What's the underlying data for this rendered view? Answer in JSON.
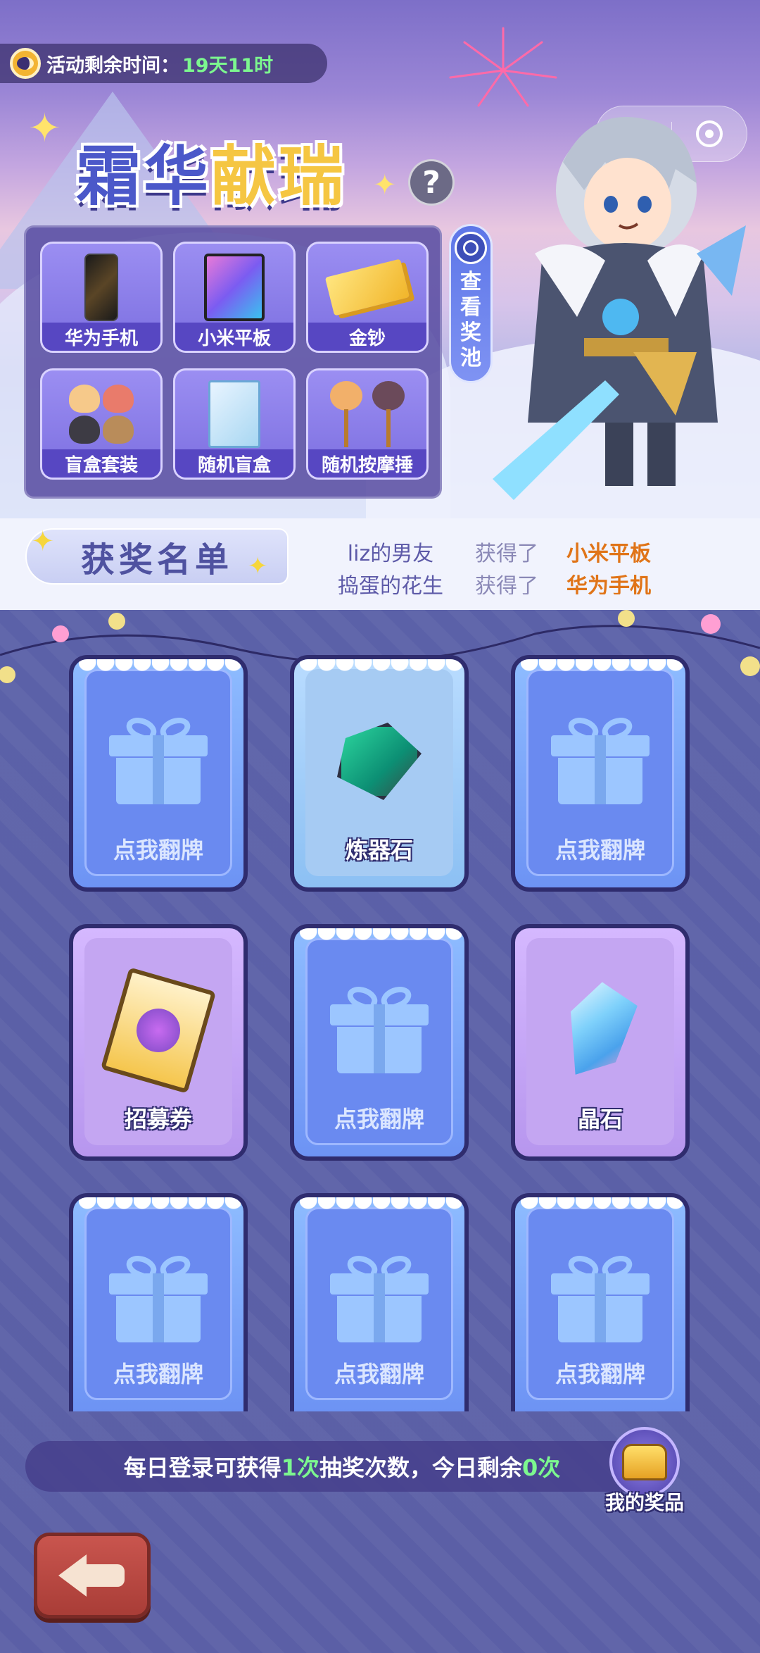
{
  "event": {
    "timer_label": "活动剩余时间：",
    "timer_value": "19天11时",
    "title_part1": "霜华",
    "title_part2": "献瑞",
    "help": "?"
  },
  "miniapp_menu": {
    "more": "•••"
  },
  "prize_pool": {
    "view_button": "查看奖池",
    "items": [
      {
        "label": "华为手机",
        "icon": "phone-icon"
      },
      {
        "label": "小米平板",
        "icon": "tablet-icon"
      },
      {
        "label": "金钞",
        "icon": "gold-note-icon"
      },
      {
        "label": "盲盒套装",
        "icon": "blindbox-set-icon"
      },
      {
        "label": "随机盲盒",
        "icon": "blindbox-icon"
      },
      {
        "label": "随机按摩捶",
        "icon": "massage-hammer-icon"
      }
    ]
  },
  "winners": {
    "title": "获奖名单",
    "rows": [
      {
        "name": "liz的男友",
        "action": "获得了",
        "item": "小米平板"
      },
      {
        "name": "捣蛋的花生",
        "action": "获得了",
        "item": "华为手机"
      }
    ]
  },
  "cards": [
    {
      "state": "back",
      "caption": "点我翻牌"
    },
    {
      "state": "revealed",
      "caption": "炼器石",
      "icon": "refining-stone-icon"
    },
    {
      "state": "back",
      "caption": "点我翻牌"
    },
    {
      "state": "revealed",
      "caption": "招募券",
      "icon": "recruit-ticket-icon"
    },
    {
      "state": "back",
      "caption": "点我翻牌"
    },
    {
      "state": "revealed",
      "caption": "晶石",
      "icon": "crystal-icon"
    },
    {
      "state": "back",
      "caption": "点我翻牌"
    },
    {
      "state": "back",
      "caption": "点我翻牌"
    },
    {
      "state": "back",
      "caption": "点我翻牌"
    }
  ],
  "footer": {
    "info_prefix": "每日登录可获得",
    "info_count": "1次",
    "info_middle": "抽奖次数，今日剩余",
    "info_remaining": "0次",
    "my_prizes": "我的奖品"
  },
  "colors": {
    "accent_green": "#7cf78f",
    "highlight_orange": "#e07418"
  }
}
